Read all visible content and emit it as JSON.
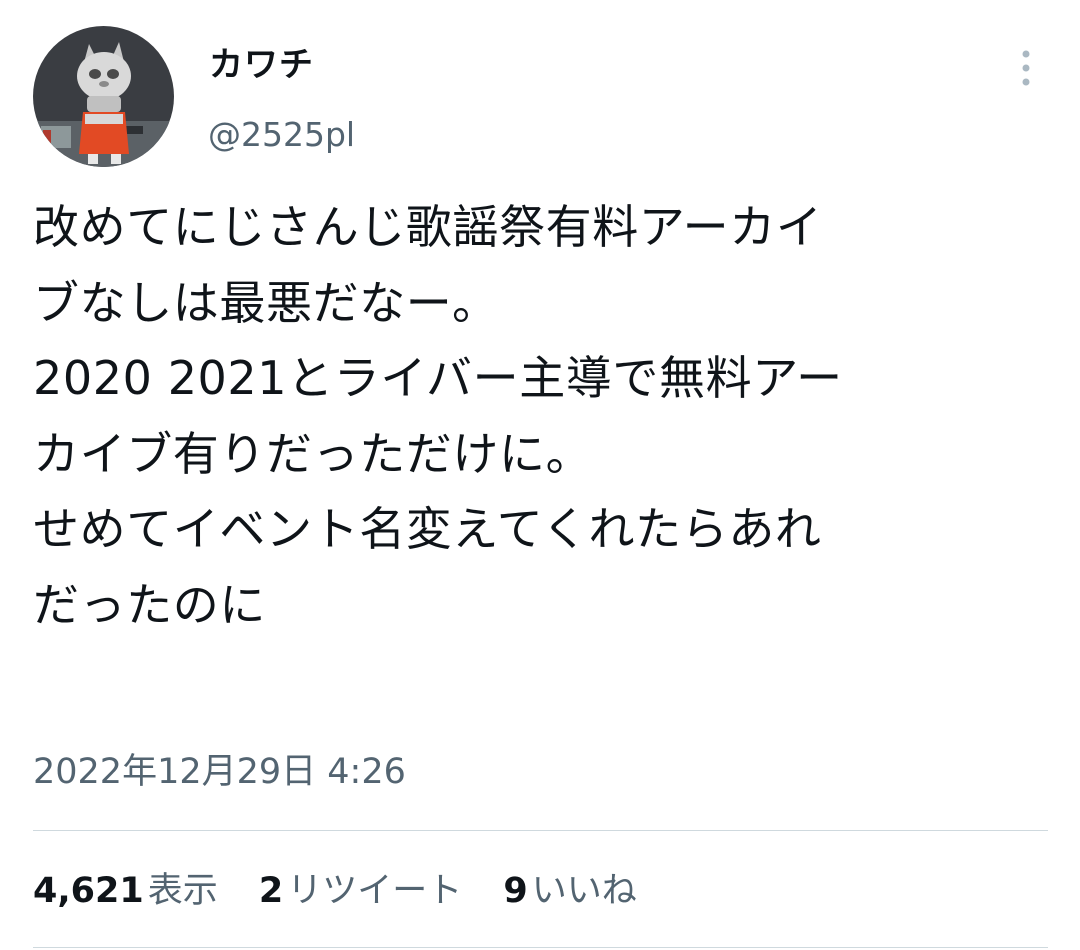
{
  "tweet": {
    "author": {
      "display_name": "カワチ",
      "handle": "@2525pl"
    },
    "text_lines": [
      "改めてにじさんじ歌謡祭有料アーカイ",
      "ブなしは最悪だなー。",
      "2020 2021とライバー主導で無料アー",
      "カイブ有りだっただけに。",
      "せめてイベント名変えてくれたらあれ",
      "だったのに"
    ],
    "timestamp": "2022年12月29日 4:26",
    "stats": {
      "views_count": "4,621",
      "views_label": "表示",
      "retweets_count": "2",
      "retweets_label": "リツイート",
      "likes_count": "9",
      "likes_label": "いいね"
    }
  },
  "icons": {
    "more": "more-vertical-icon"
  },
  "colors": {
    "text": "#0f1419",
    "secondary": "#536471",
    "divider": "#cfd9de",
    "more_icon": "#aab8c2"
  }
}
